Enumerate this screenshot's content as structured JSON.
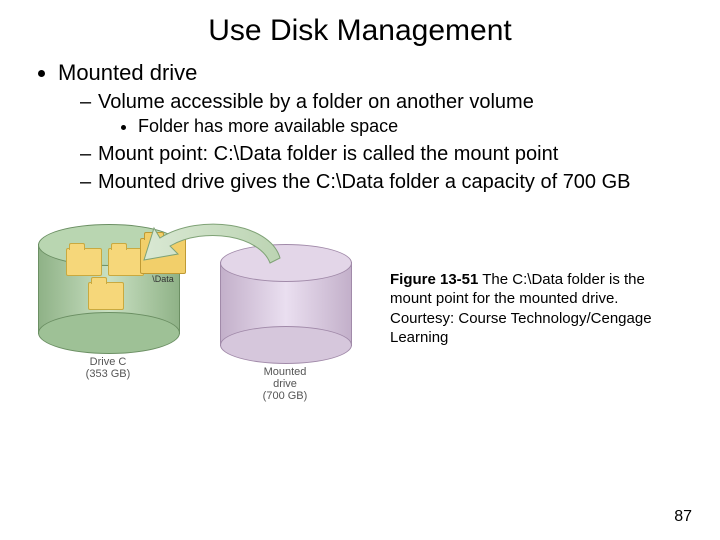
{
  "title": "Use Disk Management",
  "bullets": {
    "l1": "Mounted drive",
    "s1": "Volume accessible by a folder on another volume",
    "ss1": "Folder has more available space",
    "s2": "Mount point: C:\\Data folder is called the mount point",
    "s3": "Mounted drive gives the C:\\Data folder a capacity of 700 GB"
  },
  "diagram": {
    "data_folder_label": "\\Data",
    "driveA_caption": "Drive C\n(353 GB)",
    "driveB_caption": "Mounted\ndrive\n(700 GB)"
  },
  "caption": {
    "figno": "Figure 13-51",
    "text": " The C:\\Data folder is the mount point for the mounted drive. Courtesy: Course Technology/Cengage Learning"
  },
  "page": "87"
}
